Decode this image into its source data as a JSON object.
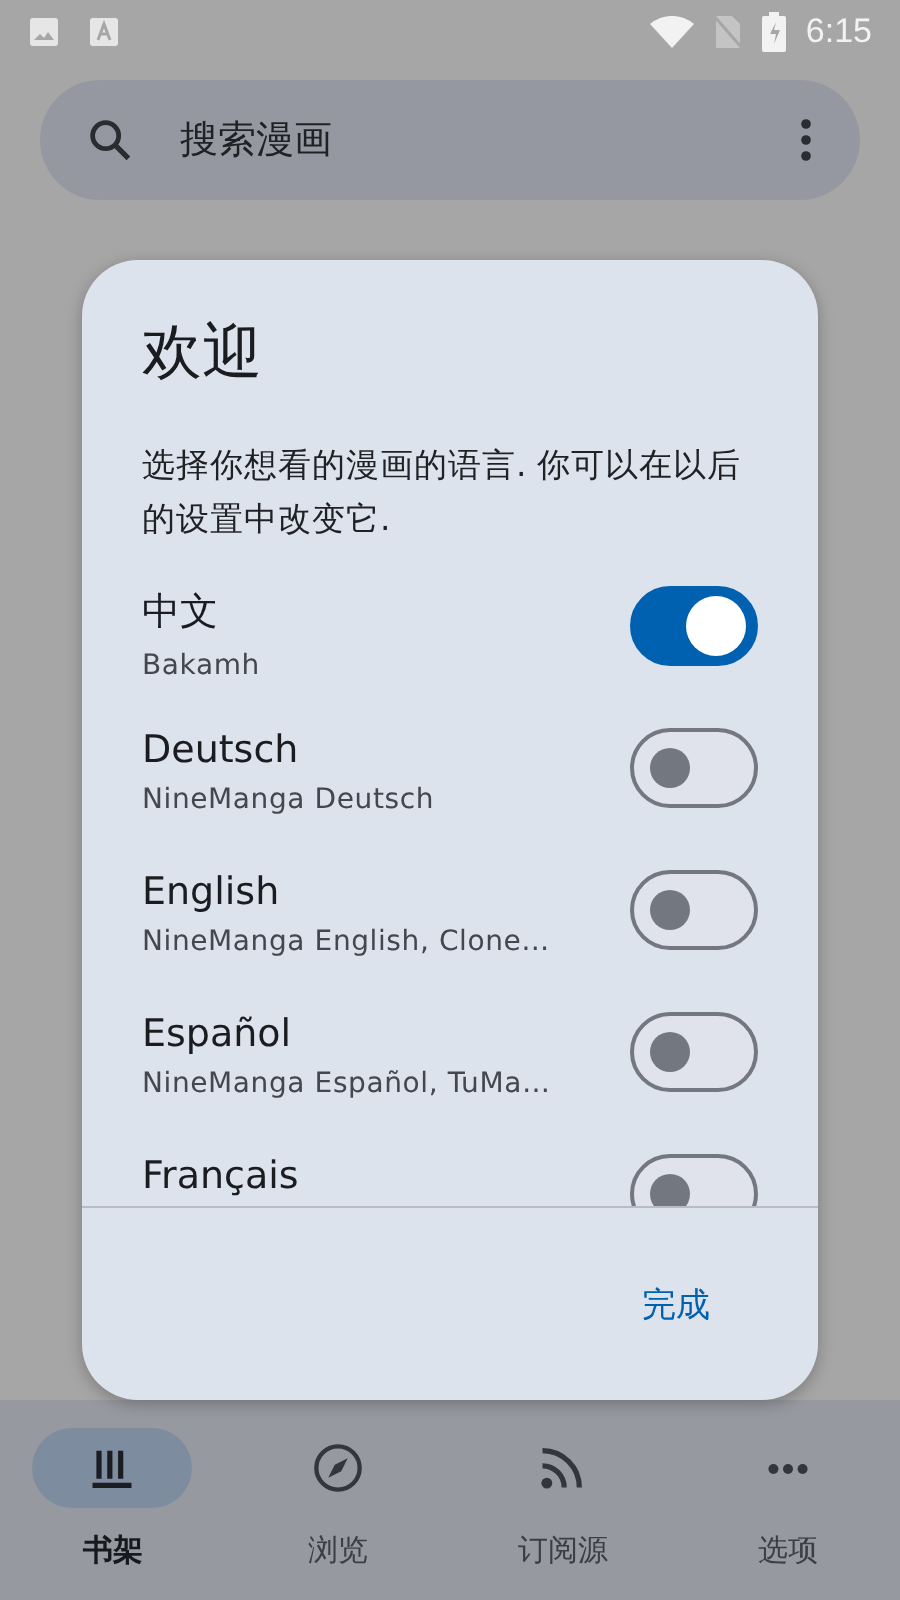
{
  "status_bar": {
    "time": "6:15"
  },
  "search": {
    "placeholder": "搜索漫画"
  },
  "dialog": {
    "title": "欢迎",
    "message": "选择你想看的漫画的语言. 你可以在以后的设置中改变它.",
    "languages": [
      {
        "name": "中文",
        "sources": "Bakamh",
        "on": true
      },
      {
        "name": "Deutsch",
        "sources": "NineManga Deutsch",
        "on": false
      },
      {
        "name": "English",
        "sources": "NineManga English, Clone…",
        "on": false
      },
      {
        "name": "Español",
        "sources": "NineManga Español, TuMa…",
        "on": false
      },
      {
        "name": "Français",
        "on": false
      }
    ],
    "confirm": "完成"
  },
  "bottom_nav": [
    {
      "label": "书架",
      "kind": "library",
      "selected": true
    },
    {
      "label": "浏览",
      "kind": "browse",
      "selected": false
    },
    {
      "label": "订阅源",
      "kind": "feeds",
      "selected": false
    },
    {
      "label": "选项",
      "kind": "more",
      "selected": false
    }
  ]
}
